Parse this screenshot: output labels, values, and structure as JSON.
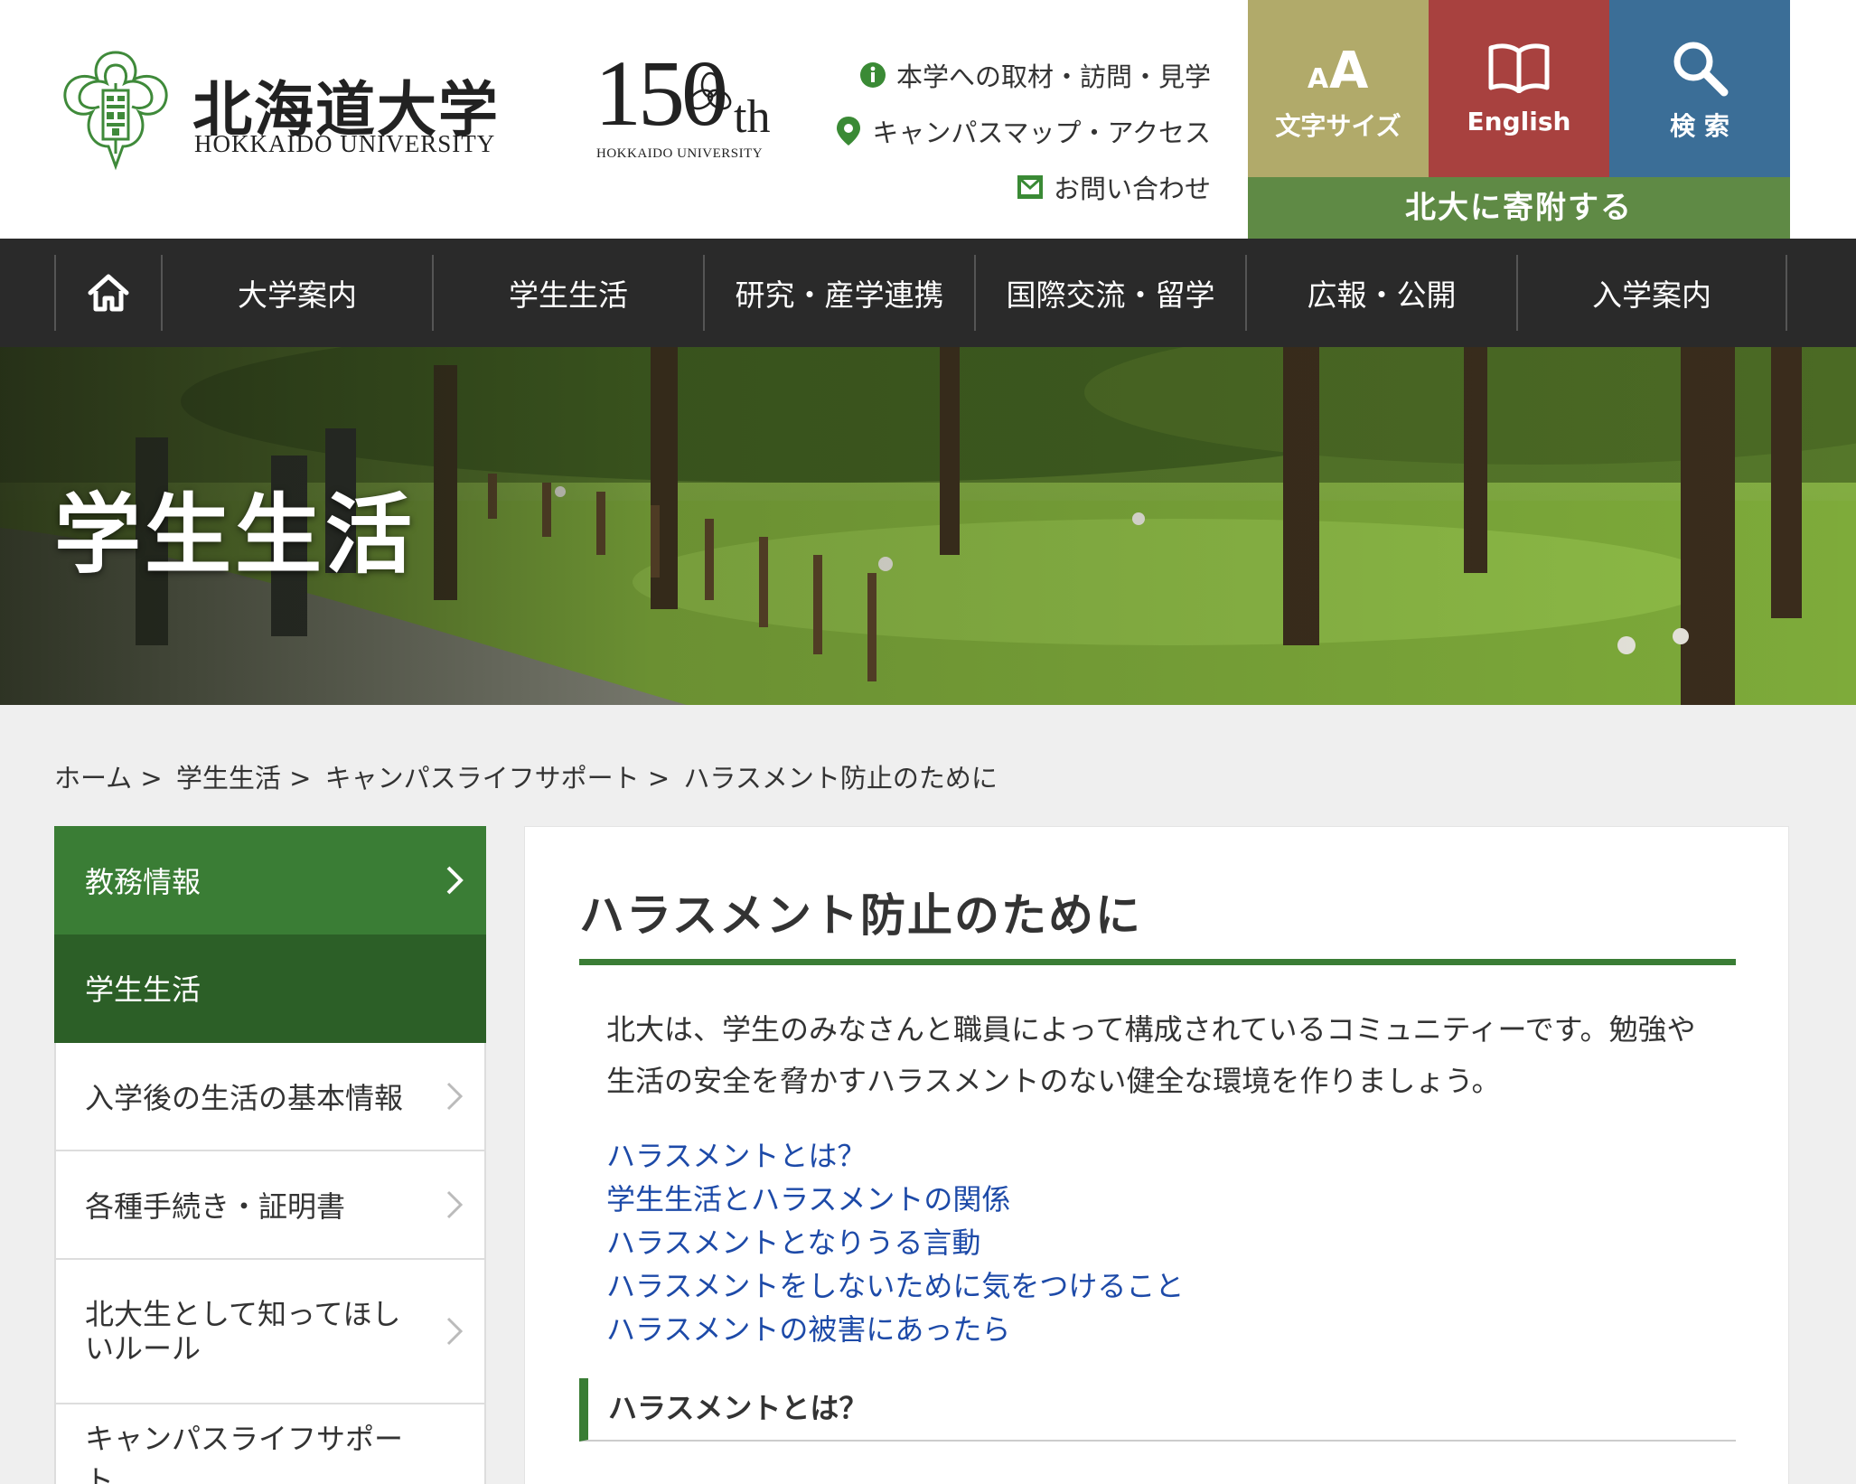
{
  "header": {
    "logo_ja": "北海道大学",
    "logo_en": "HOKKAIDO UNIVERSITY",
    "anniversary": {
      "number": "150",
      "suffix": "th",
      "sub": "HOKKAIDO UNIVERSITY"
    },
    "utility_links": [
      {
        "label": "本学への取材・訪問・見学",
        "icon": "info-icon"
      },
      {
        "label": "キャンパスマップ・アクセス",
        "icon": "map-pin-icon"
      },
      {
        "label": "お問い合わせ",
        "icon": "mail-icon"
      }
    ],
    "tiles": {
      "fontsize": {
        "label": "文字サイズ",
        "icon": "font-size-icon",
        "color": "#b1aa6a"
      },
      "english": {
        "label": "English",
        "icon": "book-icon",
        "color": "#a8413f"
      },
      "search": {
        "label": "検 索",
        "icon": "search-icon",
        "color": "#3b6e97"
      }
    },
    "donate": {
      "label": "北大に寄附する",
      "color": "#5f8a45"
    }
  },
  "gnav": {
    "home_icon": "home-icon",
    "items": [
      "大学案内",
      "学生生活",
      "研究・産学連携",
      "国際交流・留学",
      "広報・公開",
      "入学案内"
    ]
  },
  "hero": {
    "title": "学生生活"
  },
  "breadcrumb": [
    "ホーム",
    ">",
    "学生生活",
    ">",
    "キャンパスライフサポート",
    ">",
    "ハラスメント防止のために"
  ],
  "sidebar": {
    "items": [
      {
        "label": "教務情報"
      },
      {
        "label": "学生生活"
      },
      {
        "label": "入学後の生活の基本情報"
      },
      {
        "label": "各種手続き・証明書"
      },
      {
        "label": "北大生として知ってほしいルール"
      },
      {
        "label": "キャンパスライフサポート"
      }
    ]
  },
  "content": {
    "title": "ハラスメント防止のために",
    "intro": "北大は、学生のみなさんと職員によって構成されているコミュニティーです。勉強や生活の安全を脅かすハラスメントのない健全な環境を作りましょう。",
    "toc": [
      "ハラスメントとは？",
      "学生生活とハラスメントの関係",
      "ハラスメントとなりうる言動",
      "ハラスメントをしないために気をつけること",
      "ハラスメントの被害にあったら"
    ],
    "section_title": "ハラスメントとは？"
  },
  "colors": {
    "accent_green": "#3a7d35",
    "link_blue": "#1d4aa8",
    "nav_dark": "#2a2a2a"
  }
}
